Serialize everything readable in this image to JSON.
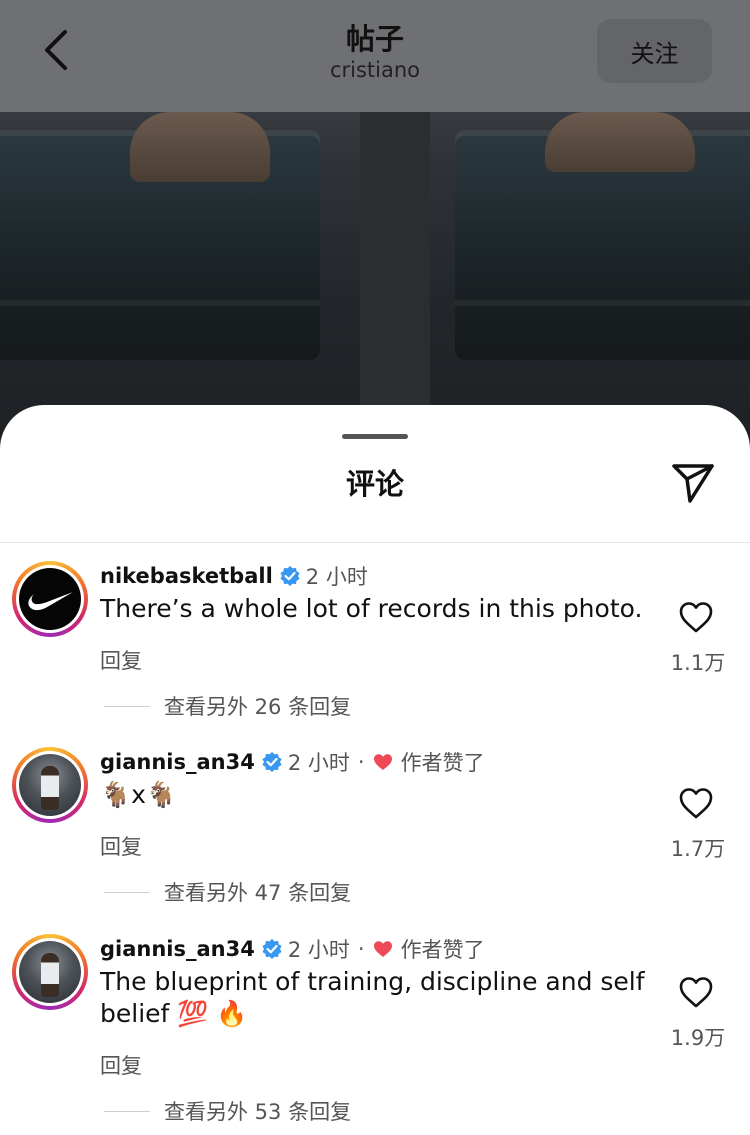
{
  "topbar": {
    "title": "帖子",
    "subtitle": "cristiano",
    "follow_label": "关注"
  },
  "sheet": {
    "title": "评论"
  },
  "comments": [
    {
      "username": "nikebasketball",
      "verified": true,
      "time": "2 小时",
      "text": "There’s a whole lot of records in this photo.",
      "reply_label": "回复",
      "likes": "1.1万",
      "more_replies": "查看另外 26 条回复"
    },
    {
      "username": "giannis_an34",
      "verified": true,
      "time": "2 小时",
      "dot": "·",
      "author_liked": "作者赞了",
      "text": "🐐x🐐",
      "reply_label": "回复",
      "likes": "1.7万",
      "more_replies": "查看另外 47 条回复"
    },
    {
      "username": "giannis_an34",
      "verified": true,
      "time": "2 小时",
      "dot": "·",
      "author_liked": "作者赞了",
      "text": "The blueprint of training, discipline and self belief 💯 🔥",
      "reply_label": "回复",
      "likes": "1.9万",
      "more_replies": "查看另外 53 条回复"
    }
  ],
  "colors": {
    "verified_blue": "#3897f0",
    "liked_red": "#ed4956"
  }
}
